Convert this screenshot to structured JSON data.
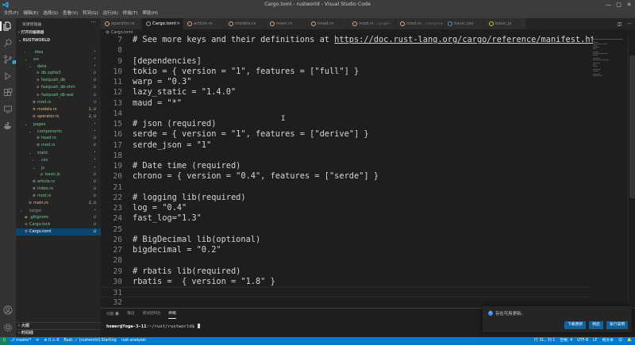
{
  "window": {
    "title": "Cargo.toml - rustworld - Visual Studio Code",
    "min": "—",
    "max": "□",
    "close": "✕"
  },
  "menu": [
    "文件(F)",
    "编辑(E)",
    "选择(S)",
    "查看(V)",
    "转到(G)",
    "运行(R)",
    "终端(T)",
    "帮助(H)"
  ],
  "sidebar": {
    "title": "资源管理器",
    "more": "···",
    "open_editors": "打开的编辑器",
    "project": "RUSTWORLD",
    "tree": [
      {
        "label": ".idea",
        "indent": 1,
        "chev": "›",
        "icon": "",
        "status": "",
        "color": "green"
      },
      {
        "label": "src",
        "indent": 1,
        "chev": "⌄",
        "icon": "",
        "status": "",
        "color": "green"
      },
      {
        "label": "data",
        "indent": 2,
        "chev": "⌄",
        "icon": "",
        "status": "",
        "color": "green"
      },
      {
        "label": "db.sqlite3",
        "indent": 3,
        "chev": "",
        "icon": "≡",
        "status": "U",
        "color": "green"
      },
      {
        "label": "fastpush_db",
        "indent": 3,
        "chev": "",
        "icon": "≡",
        "status": "U",
        "color": "green"
      },
      {
        "label": "fastpush_db-shm",
        "indent": 3,
        "chev": "",
        "icon": "≡",
        "status": "U",
        "color": "green"
      },
      {
        "label": "fastpush_db-wal",
        "indent": 3,
        "chev": "",
        "icon": "≡",
        "status": "U",
        "color": "green"
      },
      {
        "label": "mod.rs",
        "indent": 2,
        "chev": "",
        "icon": "⚙",
        "status": "U",
        "color": "green"
      },
      {
        "label": "models.rs",
        "indent": 2,
        "chev": "",
        "icon": "⚙",
        "status": "2, U",
        "color": "orange"
      },
      {
        "label": "operator.rs",
        "indent": 2,
        "chev": "",
        "icon": "⚙",
        "status": "2, U",
        "color": "orange"
      },
      {
        "label": "pages",
        "indent": 1,
        "chev": "⌄",
        "icon": "",
        "status": "",
        "color": "green"
      },
      {
        "label": "components",
        "indent": 2,
        "chev": "⌄",
        "icon": "",
        "status": "",
        "color": "green"
      },
      {
        "label": "head.rs",
        "indent": 3,
        "chev": "",
        "icon": "⚙",
        "status": "U",
        "color": "green"
      },
      {
        "label": "mod.rs",
        "indent": 3,
        "chev": "",
        "icon": "⚙",
        "status": "U",
        "color": "green"
      },
      {
        "label": "static",
        "indent": 2,
        "chev": "⌄",
        "icon": "",
        "status": "",
        "color": "green"
      },
      {
        "label": "css",
        "indent": 3,
        "chev": "›",
        "icon": "",
        "status": "",
        "color": "green"
      },
      {
        "label": "js",
        "indent": 3,
        "chev": "⌄",
        "icon": "",
        "status": "",
        "color": "green"
      },
      {
        "label": "basic.js",
        "indent": 4,
        "chev": "",
        "icon": "JS",
        "status": "U",
        "color": "green"
      },
      {
        "label": "article.rs",
        "indent": 2,
        "chev": "",
        "icon": "⚙",
        "status": "U",
        "color": "green"
      },
      {
        "label": "index.rs",
        "indent": 2,
        "chev": "",
        "icon": "⚙",
        "status": "U",
        "color": "green"
      },
      {
        "label": "mod.rs",
        "indent": 2,
        "chev": "",
        "icon": "⚙",
        "status": "U",
        "color": "green"
      },
      {
        "label": "main.rs",
        "indent": 1,
        "chev": "",
        "icon": "⚙",
        "status": "2, U",
        "color": "orange"
      },
      {
        "label": "target",
        "indent": 0,
        "chev": "›",
        "icon": "",
        "status": "",
        "color": "gray"
      },
      {
        "label": ".gitignore",
        "indent": 0,
        "chev": "",
        "icon": "◆",
        "status": "U",
        "color": "green"
      },
      {
        "label": "Cargo.lock",
        "indent": 0,
        "chev": "",
        "icon": "≡",
        "status": "U",
        "color": "green"
      },
      {
        "label": "Cargo.toml",
        "indent": 0,
        "chev": "",
        "icon": "⚙",
        "status": "U",
        "color": "white",
        "selected": true
      }
    ],
    "outline": "大纲",
    "timeline": "时间线"
  },
  "tabs": [
    {
      "label": "operator.rs",
      "desc": "",
      "active": false,
      "icon_color": "#dea584"
    },
    {
      "label": "Cargo.toml",
      "desc": "",
      "active": true,
      "icon_color": "#9e9e9e"
    },
    {
      "label": "article.rs",
      "desc": "",
      "active": false,
      "icon_color": "#dea584"
    },
    {
      "label": "models.rs",
      "desc": "",
      "active": false,
      "icon_color": "#dea584"
    },
    {
      "label": "main.rs",
      "desc": "",
      "active": false,
      "icon_color": "#dea584"
    },
    {
      "label": "head.rs",
      "desc": "",
      "active": false,
      "icon_color": "#dea584"
    },
    {
      "label": "mod.rs",
      "desc": "...\\pages",
      "active": false,
      "icon_color": "#dea584"
    },
    {
      "label": "mod.rs",
      "desc": "...\\components",
      "active": false,
      "icon_color": "#dea584"
    },
    {
      "label": "basic.css",
      "desc": "",
      "active": false,
      "icon_color": "#519aba"
    },
    {
      "label": "basic.js",
      "desc": "",
      "active": false,
      "icon_color": "#cbcb41"
    }
  ],
  "breadcrumb": "Cargo.toml",
  "code": [
    {
      "n": "7",
      "text": "# See more keys and their definitions at ",
      "link": "https://doc.rust-lang.org/cargo/reference/manifest.html"
    },
    {
      "n": "8",
      "text": ""
    },
    {
      "n": "9",
      "text": "[dependencies]"
    },
    {
      "n": "10",
      "text": "tokio = { version = \"1\", features = [\"full\"] }"
    },
    {
      "n": "11",
      "text": "warp = \"0.3\""
    },
    {
      "n": "12",
      "text": "lazy_static = \"1.4.0\""
    },
    {
      "n": "13",
      "text": "maud = \"*\""
    },
    {
      "n": "14",
      "text": ""
    },
    {
      "n": "15",
      "text": "# json (required)"
    },
    {
      "n": "16",
      "text": "serde = { version = \"1\", features = [\"derive\"] }"
    },
    {
      "n": "17",
      "text": "serde_json = \"1\""
    },
    {
      "n": "18",
      "text": ""
    },
    {
      "n": "19",
      "text": "# Date time (required)"
    },
    {
      "n": "20",
      "text": "chrono = { version = \"0.4\", features = [\"serde\"] }"
    },
    {
      "n": "21",
      "text": ""
    },
    {
      "n": "22",
      "text": "# logging lib(required)"
    },
    {
      "n": "23",
      "text": "log = \"0.4\""
    },
    {
      "n": "24",
      "text": "fast_log=\"1.3\""
    },
    {
      "n": "25",
      "text": ""
    },
    {
      "n": "26",
      "text": "# BigDecimal lib(optional)"
    },
    {
      "n": "27",
      "text": "bigdecimal = \"0.2\""
    },
    {
      "n": "28",
      "text": ""
    },
    {
      "n": "29",
      "text": "# rbatis lib(required)"
    },
    {
      "n": "30",
      "text": "rbatis =  { version = \"1.8\" }"
    },
    {
      "n": "31",
      "text": ""
    },
    {
      "n": "32",
      "text": ""
    }
  ],
  "panel": {
    "tabs": [
      {
        "label": "问题",
        "badge": "6",
        "active": false
      },
      {
        "label": "输出",
        "badge": "",
        "active": false
      },
      {
        "label": "调试控制台",
        "badge": "",
        "active": false
      },
      {
        "label": "终端",
        "badge": "",
        "active": true
      }
    ],
    "prompt_user": "homer@Yoga-3-11",
    "prompt_path": ":~/rust/rustworld$ "
  },
  "notification": {
    "text": "存在可用更新。",
    "buttons": [
      "下载更新",
      "稍后",
      "发行说明"
    ]
  },
  "status": {
    "remote": "⟩⟨",
    "branch": "master*",
    "sync": "⟳",
    "problems": "⊗ 0 ⚠ 6",
    "rust": "Rust: ✓ [rustworld] Starting",
    "analyzer": "rust-analyzer",
    "position": "行 31，列 1",
    "spaces": "空格: 4",
    "encoding": "UTF-8",
    "eol": "LF",
    "lang": "纯文本"
  },
  "colors": {
    "accent": "#007acc",
    "untracked": "#73c991",
    "modified": "#e2c08d",
    "selection": "#094771"
  }
}
